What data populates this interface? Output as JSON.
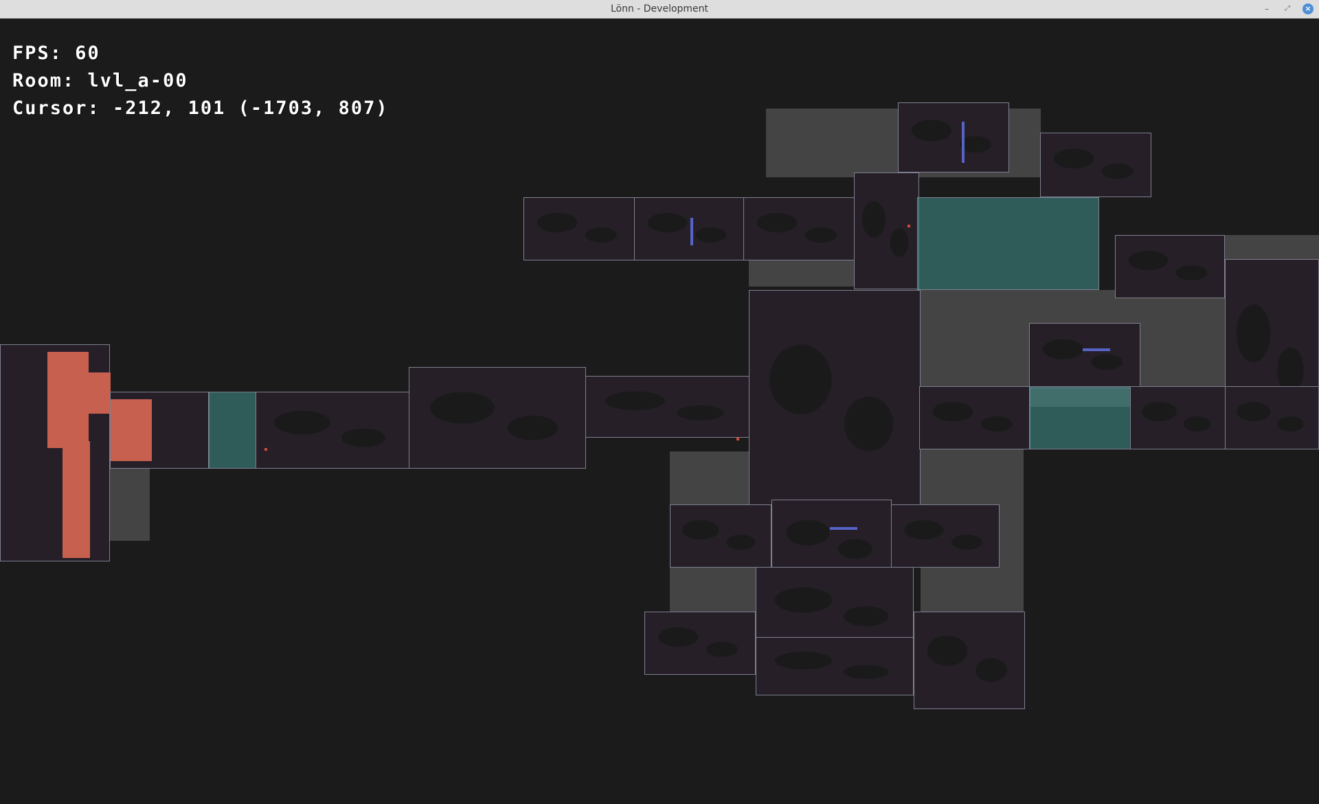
{
  "window": {
    "title": "Lönn - Development",
    "minimize_label": "–",
    "maximize_label": "⤢",
    "close_label": "×"
  },
  "hud": {
    "fps": "FPS: 60",
    "room": "Room: lvl_a-00",
    "cursor": "Cursor: -212, 101 (-1703, 807)"
  },
  "colors": {
    "background": "#1b1b1b",
    "filler": "#444444",
    "room_fill": "#261f28",
    "room_border": "#7e8090",
    "highlight": "#408f8c",
    "tile_accent": "#5663c7",
    "lava": "#c7604f"
  }
}
